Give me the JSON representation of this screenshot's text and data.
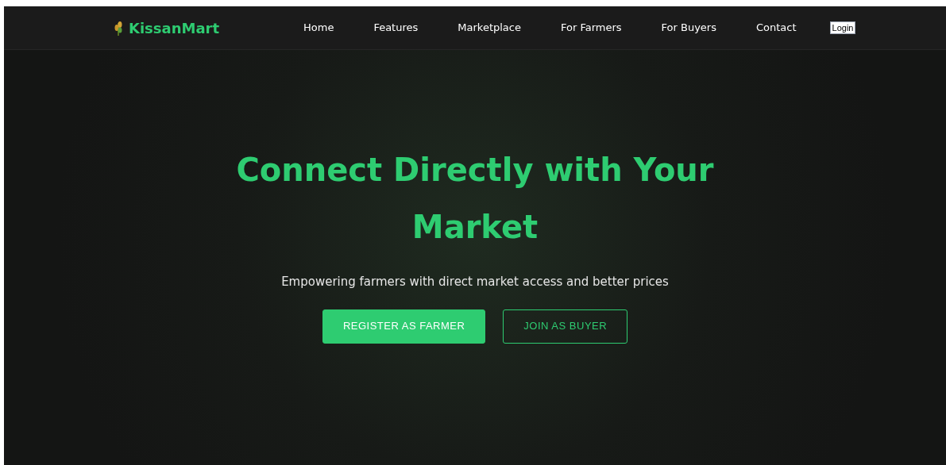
{
  "brand": {
    "name": "KissanMart"
  },
  "nav": [
    {
      "label": "Home"
    },
    {
      "label": "Features"
    },
    {
      "label": "Marketplace"
    },
    {
      "label": "For Farmers"
    },
    {
      "label": "For Buyers"
    },
    {
      "label": "Contact"
    }
  ],
  "login": {
    "label": "Login"
  },
  "hero": {
    "title": "Connect Directly with Your Market",
    "subtitle": "Empowering farmers with direct market access and better prices",
    "buttons": [
      {
        "label": "REGISTER AS FARMER",
        "kind": "primary"
      },
      {
        "label": "JOIN AS BUYER",
        "kind": "outline"
      }
    ]
  }
}
